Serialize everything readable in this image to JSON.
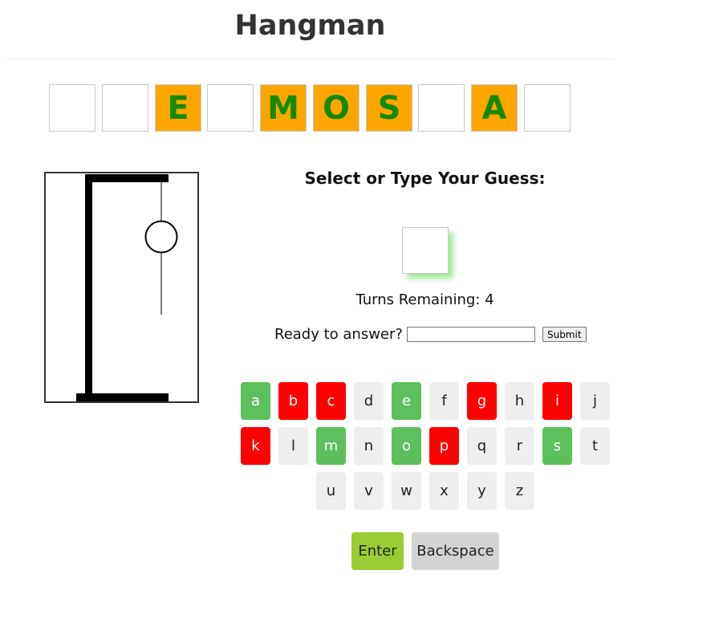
{
  "header": {
    "title": "Hangman"
  },
  "word": {
    "tiles": [
      {
        "letter": "",
        "revealed": false
      },
      {
        "letter": "",
        "revealed": false
      },
      {
        "letter": "E",
        "revealed": true
      },
      {
        "letter": "",
        "revealed": false
      },
      {
        "letter": "M",
        "revealed": true
      },
      {
        "letter": "O",
        "revealed": true
      },
      {
        "letter": "S",
        "revealed": true
      },
      {
        "letter": "",
        "revealed": false
      },
      {
        "letter": "A",
        "revealed": true
      },
      {
        "letter": "",
        "revealed": false
      }
    ],
    "revealed_color": "#ffa500",
    "letter_color": "#158a00"
  },
  "gallows": {
    "parts_drawn": [
      "rope",
      "head",
      "body"
    ]
  },
  "guess": {
    "prompt": "Select or Type Your Guess:",
    "current_letter": "",
    "turns_label": "Turns Remaining: 4",
    "turns_remaining": 4
  },
  "answer": {
    "label": "Ready to answer?",
    "input_value": "",
    "submit_label": "Submit"
  },
  "keyboard": {
    "rows": [
      [
        {
          "key": "a",
          "state": "correct"
        },
        {
          "key": "b",
          "state": "wrong"
        },
        {
          "key": "c",
          "state": "wrong"
        },
        {
          "key": "d",
          "state": "unused"
        },
        {
          "key": "e",
          "state": "correct"
        },
        {
          "key": "f",
          "state": "unused"
        },
        {
          "key": "g",
          "state": "wrong"
        },
        {
          "key": "h",
          "state": "unused"
        },
        {
          "key": "i",
          "state": "wrong"
        },
        {
          "key": "j",
          "state": "unused"
        }
      ],
      [
        {
          "key": "k",
          "state": "wrong"
        },
        {
          "key": "l",
          "state": "unused"
        },
        {
          "key": "m",
          "state": "correct"
        },
        {
          "key": "n",
          "state": "unused"
        },
        {
          "key": "o",
          "state": "correct"
        },
        {
          "key": "p",
          "state": "wrong"
        },
        {
          "key": "q",
          "state": "unused"
        },
        {
          "key": "r",
          "state": "unused"
        },
        {
          "key": "s",
          "state": "correct"
        },
        {
          "key": "t",
          "state": "unused"
        }
      ],
      [
        {
          "key": "u",
          "state": "unused"
        },
        {
          "key": "v",
          "state": "unused"
        },
        {
          "key": "w",
          "state": "unused"
        },
        {
          "key": "x",
          "state": "unused"
        },
        {
          "key": "y",
          "state": "unused"
        },
        {
          "key": "z",
          "state": "unused"
        }
      ]
    ],
    "enter_label": "Enter",
    "backspace_label": "Backspace",
    "colors": {
      "correct": "#5cc15c",
      "wrong": "#ff0000",
      "unused": "#eeeeee",
      "enter": "#9acd32",
      "backspace": "#d3d3d3"
    }
  }
}
